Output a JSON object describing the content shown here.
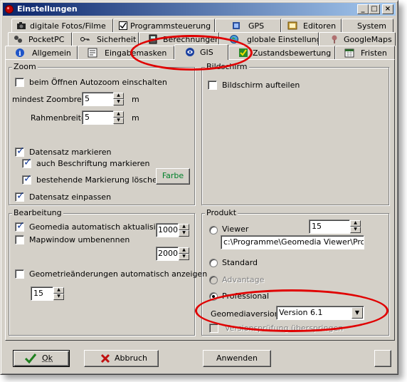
{
  "window": {
    "title": "Einstellungen",
    "min_glyph": "_",
    "max_glyph": "□",
    "close_glyph": "×"
  },
  "tabs": {
    "row1": [
      {
        "label": "digitale Fotos/Filme",
        "icon": "camera-icon"
      },
      {
        "label": "Programmsteuerung",
        "icon": "checkbox-icon"
      },
      {
        "label": "GPS",
        "icon": "satellite-icon"
      },
      {
        "label": "Editoren",
        "icon": "editor-icon"
      },
      {
        "label": "System",
        "icon": ""
      }
    ],
    "row2": [
      {
        "label": "PocketPC",
        "icon": "pocketpc-icon"
      },
      {
        "label": "Sicherheit",
        "icon": "key-icon"
      },
      {
        "label": "Berechnungen",
        "icon": "calculator-icon"
      },
      {
        "label": "globale Einstellung",
        "icon": "globe-icon"
      },
      {
        "label": "GoogleMaps",
        "icon": "pin-icon"
      }
    ],
    "row3": [
      {
        "label": "Allgemein",
        "icon": "info-icon"
      },
      {
        "label": "Eingabemasken",
        "icon": "form-icon"
      },
      {
        "label": "GIS",
        "icon": "gis-icon"
      },
      {
        "label": "Zustandsbewertung",
        "icon": "check-icon"
      },
      {
        "label": "Fristen",
        "icon": "calendar-icon"
      }
    ]
  },
  "zoom": {
    "legend": "Zoom",
    "autozoom_label": "beim Öffnen Autozoom einschalten",
    "min_zoom_label": "mindest Zoombreite",
    "min_zoom_value": "5",
    "min_zoom_unit": "m",
    "frame_label": "Rahmenbreite",
    "frame_value": "5",
    "frame_unit": "m",
    "mark_record_label": "Datensatz markieren",
    "mark_label_label": "auch Beschriftung markieren",
    "delete_marks_label": "bestehende Markierung löschen",
    "color_button": "Farbe",
    "fit_record_label": "Datensatz einpassen"
  },
  "screen": {
    "legend": "Bildschirm",
    "split_label": "Bildschirm aufteilen"
  },
  "editing": {
    "legend": "Bearbeitung",
    "auto_update_label": "Geomedia automatisch aktualisieren",
    "auto_update_value": "1000",
    "rename_label": "Mapwindow umbenennen",
    "rename_value": "2000",
    "show_changes_label": "Geometrieänderungen automatisch anzeigen",
    "show_changes_value": "15"
  },
  "product": {
    "legend": "Produkt",
    "viewer_label": "Viewer",
    "viewer_value": "15",
    "viewer_path": "c:\\Programme\\Geomedia Viewer\\Progra",
    "standard_label": "Standard",
    "advantage_label": "Advantage",
    "professional_label": "Professional",
    "version_label": "Geomediaversion",
    "version_value": "Version 6.1",
    "skip_check_label": "Versionsprüfung überspringen"
  },
  "footer": {
    "ok": "Ok",
    "cancel": "Abbruch",
    "apply": "Anwenden"
  },
  "colors": {
    "title_start": "#0a246a",
    "title_end": "#a6caf0",
    "face": "#d4d0c8",
    "annotation_red": "#e00000",
    "color_button_text": "#00802a"
  }
}
